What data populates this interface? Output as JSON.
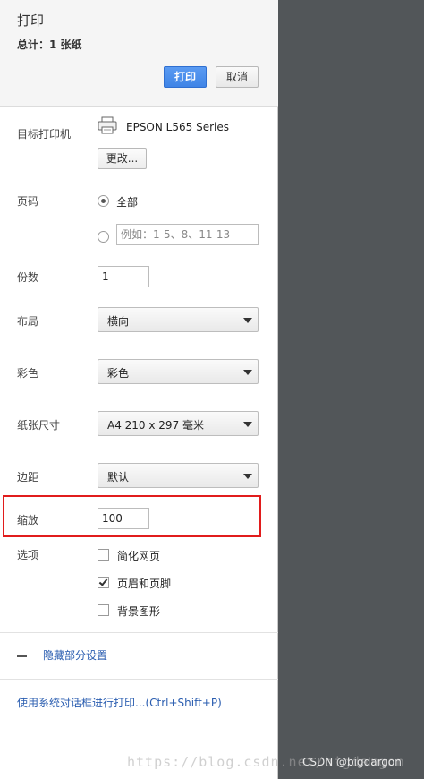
{
  "header": {
    "title": "打印",
    "summary": "总计：1 张纸",
    "print_label": "打印",
    "cancel_label": "取消"
  },
  "destination": {
    "label": "目标打印机",
    "printer_name": "EPSON L565 Series",
    "change_label": "更改..."
  },
  "pages": {
    "label": "页码",
    "all_label": "全部",
    "custom_placeholder": "例如：1-5、8、11-13",
    "selected": "all"
  },
  "copies": {
    "label": "份数",
    "value": "1"
  },
  "layout": {
    "label": "布局",
    "value": "横向"
  },
  "color": {
    "label": "彩色",
    "value": "彩色"
  },
  "paper_size": {
    "label": "纸张尺寸",
    "value": "A4 210 x 297 毫米"
  },
  "margins": {
    "label": "边距",
    "value": "默认"
  },
  "scale": {
    "label": "缩放",
    "value": "100"
  },
  "options": {
    "label": "选项",
    "items": [
      {
        "label": "简化网页",
        "checked": false
      },
      {
        "label": "页眉和页脚",
        "checked": true
      },
      {
        "label": "背景图形",
        "checked": false
      }
    ]
  },
  "footer": {
    "hide_settings_label": "隐藏部分设置",
    "system_dialog_label": "使用系统对话框进行打印...(Ctrl+Shift+P)"
  },
  "watermark": {
    "url_text": "https://blog.csdn.net/bigdargon",
    "credit": "CSDN @bigdargon"
  },
  "colors": {
    "accent": "#3f84e6",
    "highlight": "#e11c1c",
    "preview_bg": "#525659"
  }
}
